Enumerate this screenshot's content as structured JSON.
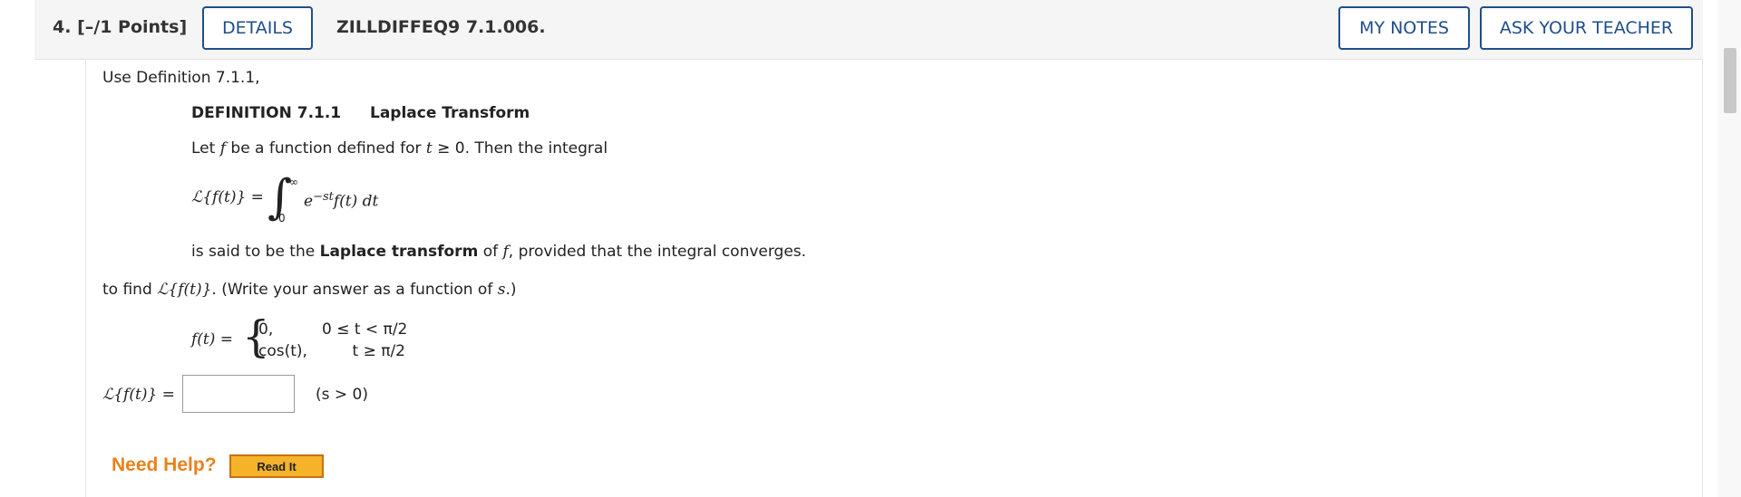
{
  "header": {
    "question_number": "4.",
    "points": "[–/1 Points]",
    "details_label": "DETAILS",
    "problem_code": "ZILLDIFFEQ9 7.1.006.",
    "my_notes_label": "MY NOTES",
    "ask_teacher_label": "ASK YOUR TEACHER"
  },
  "problem": {
    "intro": "Use Definition 7.1.1,",
    "definition_number": "DEFINITION 7.1.1",
    "definition_title": "Laplace Transform",
    "def_line1_a": "Let ",
    "def_line1_f": "f",
    "def_line1_b": " be a function defined for ",
    "def_line1_t": "t",
    "def_line1_c": " ≥ 0. Then the integral",
    "formula_lhs": "ℒ{f(t)} =",
    "integral_upper": "∞",
    "integral_lower": "0",
    "integrand_e": "e",
    "integrand_exp": "−st",
    "integrand_rest": "f(t) dt",
    "def_line2_a": "is said to be the ",
    "def_line2_bold": "Laplace transform",
    "def_line2_b": " of ",
    "def_line2_f": "f",
    "def_line2_c": ", provided that the integral converges.",
    "task_a": "to find ",
    "task_L": "ℒ{f(t)}",
    "task_b": ". (Write your answer as a function of ",
    "task_s": "s",
    "task_c": ".)",
    "piecewise_lhs": "f(t) =",
    "piece1_value": "0,",
    "piece1_condition": "0 ≤ t < π/2",
    "piece2_value": "cos(t),",
    "piece2_condition": "t ≥ π/2",
    "answer_lhs": "ℒ{f(t)} =",
    "answer_value": "",
    "answer_condition": "(s > 0)"
  },
  "help": {
    "need_help": "Need Help?",
    "read_it_label": "Read It"
  },
  "colors": {
    "accent_blue": "#1f4e8c",
    "help_orange": "#e8821c",
    "read_it_bg": "#f5b32a"
  }
}
